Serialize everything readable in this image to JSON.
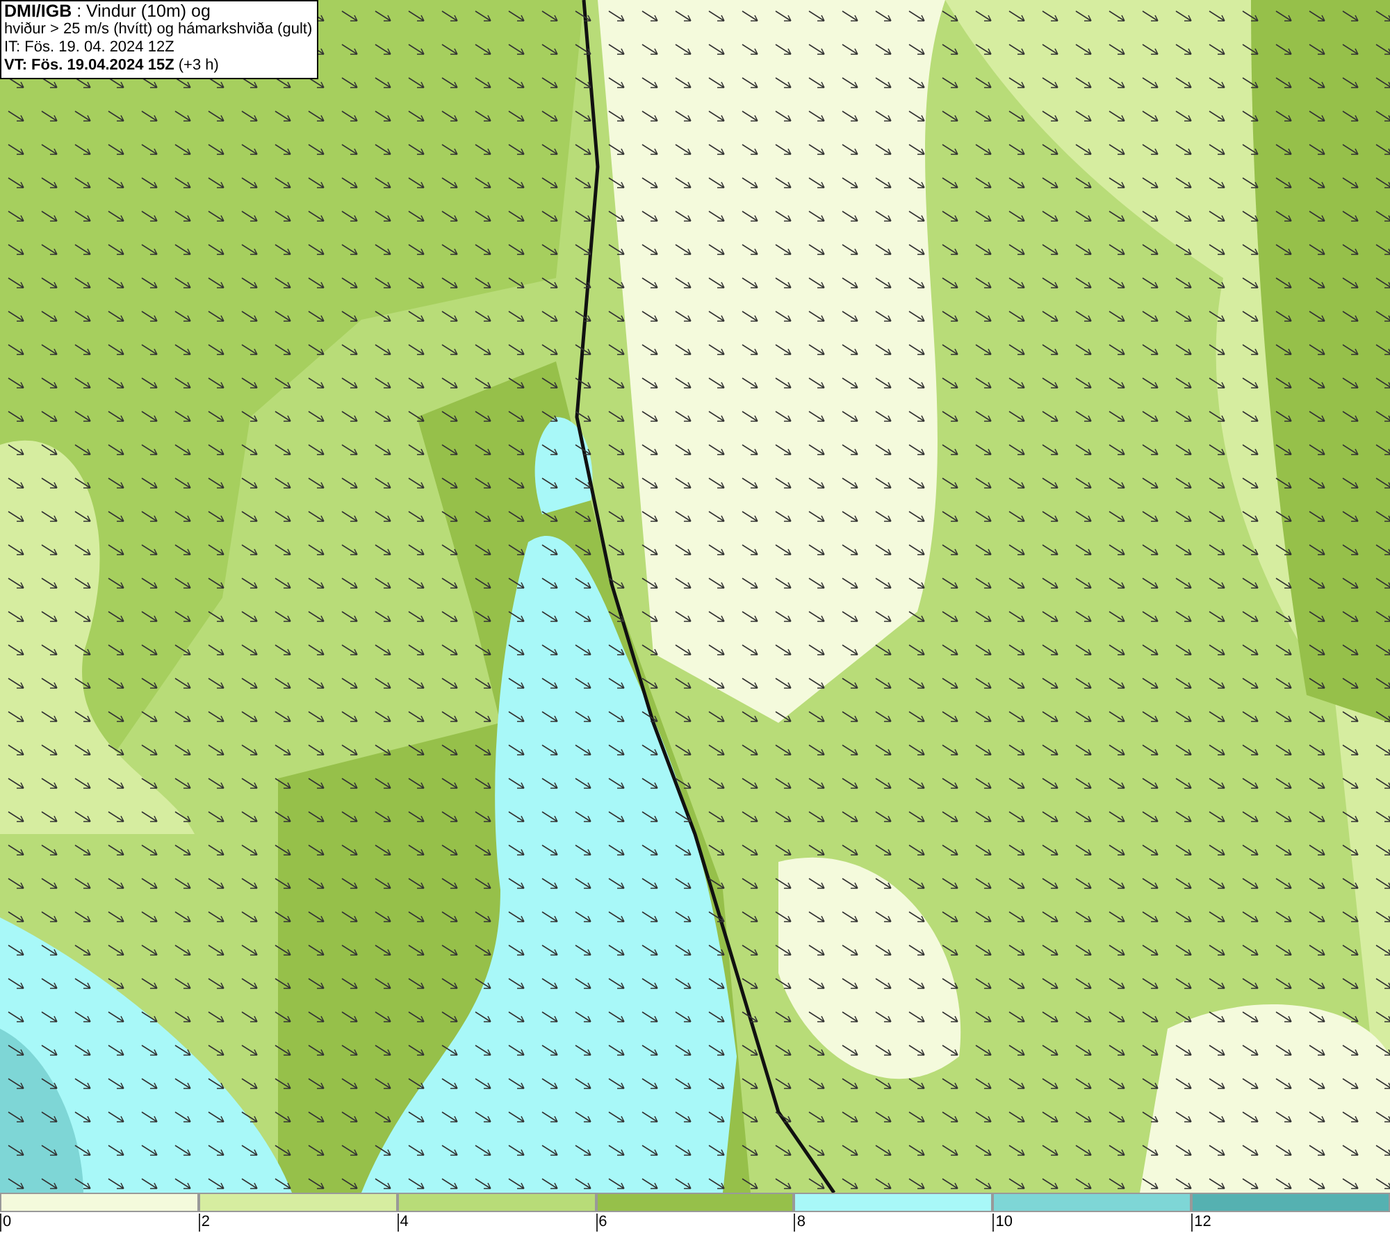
{
  "info_box": {
    "lines": [
      "**DMI/IGB** : Vindur (10m) og",
      "hviður > 25 m/s (hvítt) og hámarkshviða (gult)",
      "IT: Fös. 19. 04. 2024 12Z",
      "**VT: Fös. 19.04.2024 15Z** (+3 h)"
    ]
  },
  "legend": {
    "bins": [
      {
        "color": "#f4fadc"
      },
      {
        "color": "#d6eda0"
      },
      {
        "color": "#b8dc78"
      },
      {
        "color": "#96c04a"
      },
      {
        "color": "#a8f8f8"
      },
      {
        "color": "#7ed6d6"
      },
      {
        "color": "#55b1b1"
      }
    ],
    "ticks": [
      "0",
      "2",
      "4",
      "6",
      "8",
      "10",
      "12"
    ]
  }
}
